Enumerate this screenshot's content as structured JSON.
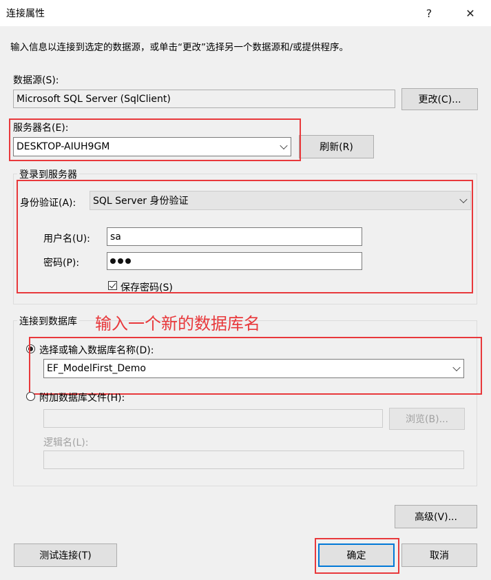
{
  "window": {
    "title": "连接属性",
    "help": "?",
    "close": "✕"
  },
  "description": "输入信息以连接到选定的数据源，或单击“更改”选择另一个数据源和/或提供程序。",
  "datasource": {
    "label": "数据源(S):",
    "value": "Microsoft SQL Server (SqlClient)",
    "change_button": "更改(C)..."
  },
  "server": {
    "label": "服务器名(E):",
    "value": "DESKTOP-AIUH9GM",
    "refresh_button": "刷新(R)"
  },
  "login": {
    "group_title": "登录到服务器",
    "auth_label": "身份验证(A):",
    "auth_value": "SQL Server 身份验证",
    "user_label": "用户名(U):",
    "user_value": "sa",
    "password_label": "密码(P):",
    "password_mask_count": 3,
    "save_password_label": "保存密码(S)",
    "save_password_checked": true
  },
  "database": {
    "group_title": "连接到数据库",
    "annotation": "输入一个新的数据库名",
    "select_option_label": "选择或输入数据库名称(D):",
    "select_option_selected": true,
    "db_name_value": "EF_ModelFirst_Demo",
    "attach_option_label": "附加数据库文件(H):",
    "attach_file_value": "",
    "browse_button": "浏览(B)...",
    "logical_name_label": "逻辑名(L):",
    "logical_name_value": ""
  },
  "buttons": {
    "advanced": "高级(V)...",
    "test": "测试连接(T)",
    "ok": "确定",
    "cancel": "取消"
  },
  "colors": {
    "highlight": "#e8383b",
    "default_button_border": "#0078d7",
    "background": "#f0f0f0"
  }
}
